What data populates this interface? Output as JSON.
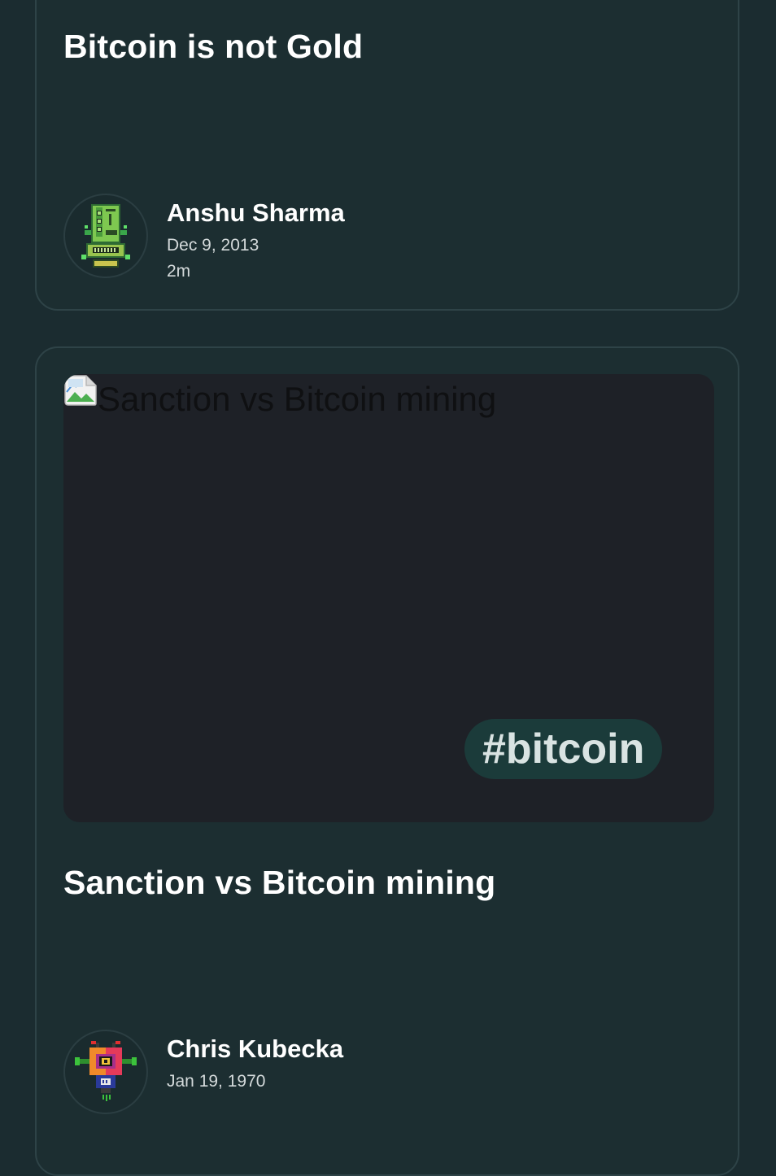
{
  "posts": [
    {
      "title": "Bitcoin is not Gold",
      "author": {
        "name": "Anshu Sharma",
        "date": "Dec 9, 2013",
        "read_time": "2m",
        "avatar_icon": "green-robot-avatar"
      }
    },
    {
      "title": "Sanction vs Bitcoin mining",
      "cover": {
        "alt_text": "Sanction vs Bitcoin mining",
        "tag": "#bitcoin",
        "icon": "broken-image-icon"
      },
      "author": {
        "name": "Chris Kubecka",
        "date": "Jan 19, 1970",
        "avatar_icon": "rainbow-robot-avatar"
      }
    }
  ],
  "colors": {
    "background": "#1b2c30",
    "card": "#1c2e31",
    "card_border": "#2e4347",
    "cover_bg": "#1e2127",
    "tag_bg": "#1b3b3a"
  }
}
